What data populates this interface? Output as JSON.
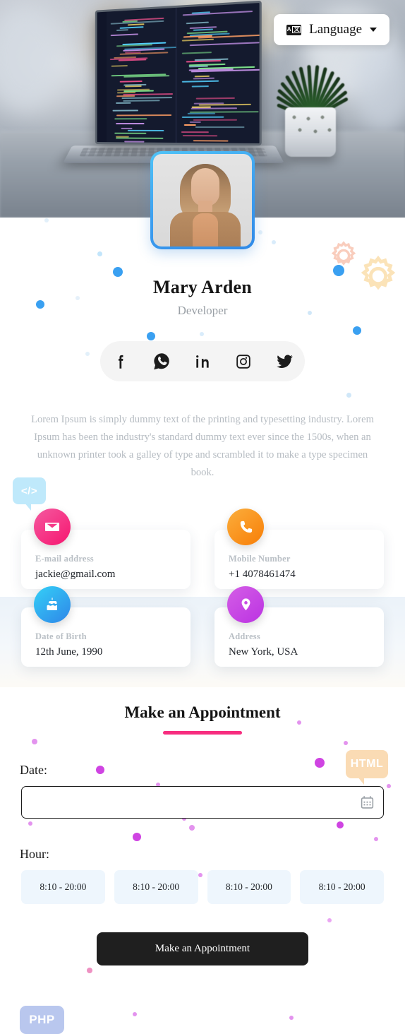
{
  "header": {
    "language_button": {
      "label": "Language",
      "icon": "translate-icon",
      "caret": "chevron-down-icon"
    }
  },
  "profile": {
    "name": "Mary Arden",
    "role": "Developer",
    "avatar_alt": "Mary Arden portrait",
    "bio": "Lorem Ipsum is simply dummy text of the printing and typesetting industry. Lorem Ipsum has been the industry's standard dummy text ever since the 1500s, when an unknown printer took a galley of type and scrambled it to make a type specimen book."
  },
  "social": [
    {
      "name": "facebook",
      "label": "Facebook"
    },
    {
      "name": "whatsapp",
      "label": "WhatsApp"
    },
    {
      "name": "linkedin",
      "label": "LinkedIn"
    },
    {
      "name": "instagram",
      "label": "Instagram"
    },
    {
      "name": "twitter",
      "label": "Twitter"
    }
  ],
  "contact_cards": [
    {
      "icon": "envelope-icon",
      "color": "#f72a7d",
      "color2": "#f45aa0",
      "label": "E-mail address",
      "value": "jackie@gmail.com"
    },
    {
      "icon": "phone-icon",
      "color": "#f98b12",
      "color2": "#fba43a",
      "label": "Mobile Number",
      "value": "+1 4078461474"
    },
    {
      "icon": "cake-icon",
      "color": "#29c6f5",
      "color2": "#2f8ae8",
      "label": "Date of Birth",
      "value": "12th June, 1990"
    },
    {
      "icon": "location-pin-icon",
      "color": "#c447e8",
      "color2": "#d35ae0",
      "label": "Address",
      "value": "New York, USA"
    }
  ],
  "appointment": {
    "title": "Make an Appointment",
    "date_label": "Date:",
    "date_value": "",
    "date_placeholder": "",
    "calendar_icon": "calendar-icon",
    "hour_label": "Hour:",
    "hours": [
      "8:10 - 20:00",
      "8:10 - 20:00",
      "8:10 - 20:00",
      "8:10 - 20:00"
    ],
    "submit_label": "Make an Appointment"
  },
  "decorations": {
    "code_badge": "</>",
    "html_badge": "HTML",
    "php_badge": "PHP"
  },
  "colors": {
    "accent_pink": "#f72d7f",
    "avatar_border": "#3ea0f0",
    "dot_blue": "#2f9bf0",
    "dot_magenta": "#cc3ae0",
    "button_dark": "#1f1f1f",
    "hour_chip_bg": "#eef6fd"
  }
}
